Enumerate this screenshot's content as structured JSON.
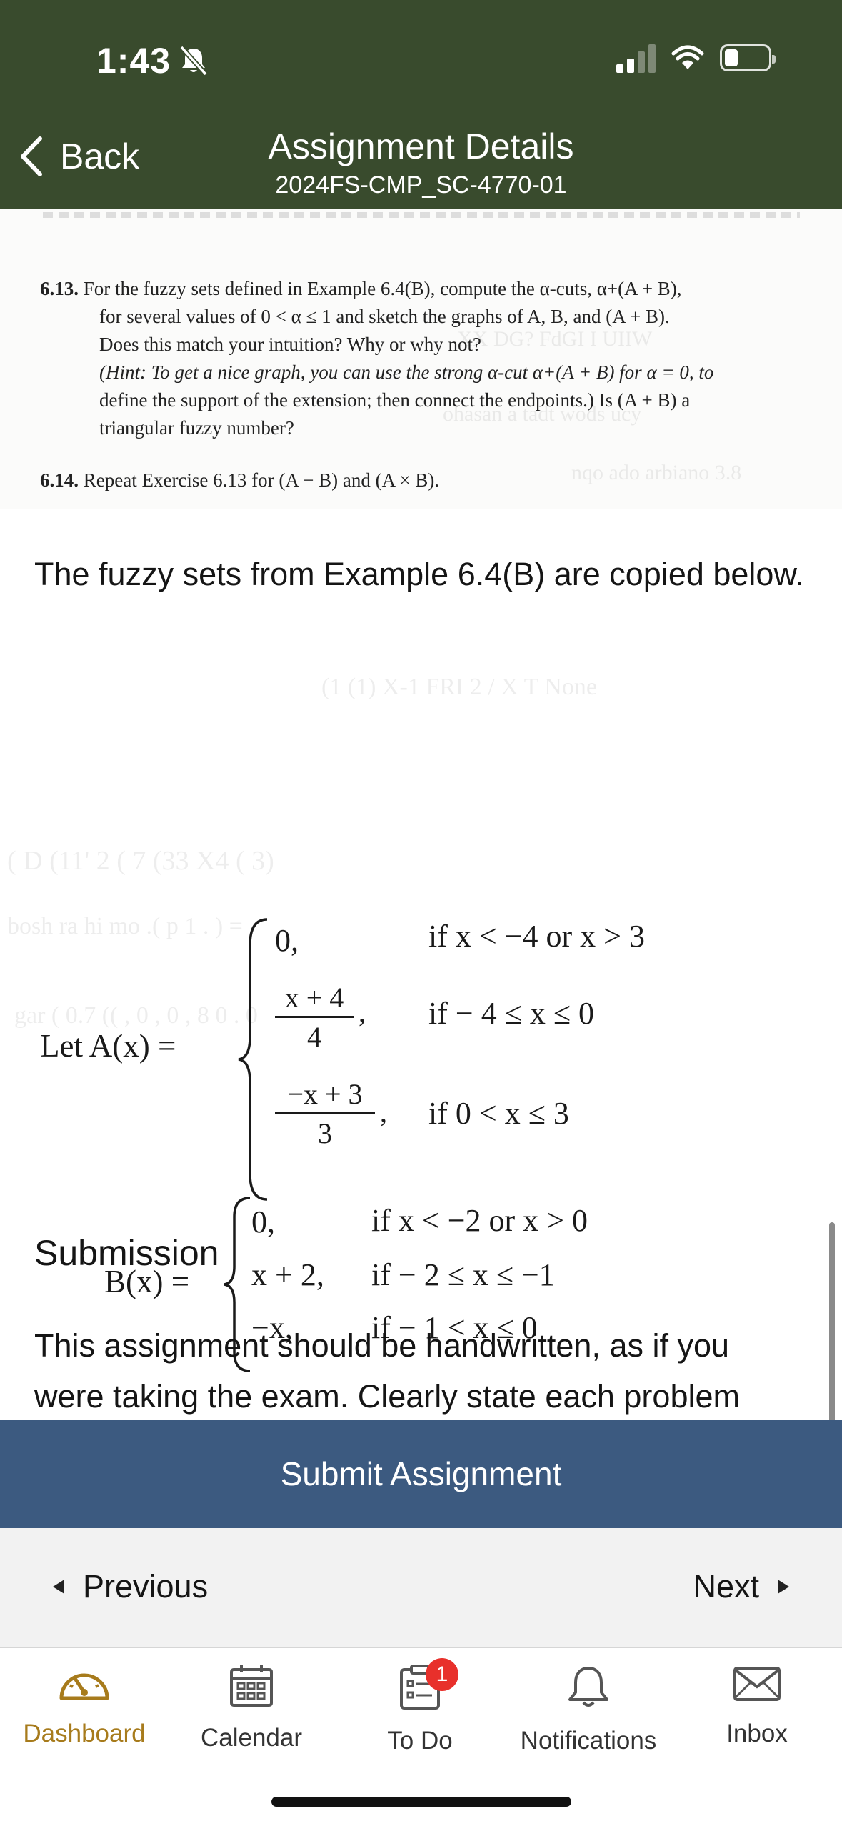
{
  "status_bar": {
    "time": "1:43"
  },
  "header": {
    "back_label": "Back",
    "title": "Assignment Details",
    "subtitle": "2024FS-CMP_SC-4770-01"
  },
  "exercises": [
    {
      "number": "6.13.",
      "lines": [
        "For the fuzzy sets defined in Example 6.4(B), compute the α-cuts, α+(A + B),",
        "for several values of 0 < α ≤ 1 and sketch the graphs of A, B, and (A + B).",
        "Does this match your intuition? Why or why not?",
        "(Hint: To get a nice graph, you can use the strong α-cut α+(A + B) for α = 0, to",
        "define the support of the extension; then connect the endpoints.) Is (A + B) a",
        "triangular fuzzy number?"
      ]
    },
    {
      "number": "6.14.",
      "lines": [
        "Repeat Exercise 6.13 for (A − B) and (A × B)."
      ]
    }
  ],
  "intro_text": "The fuzzy sets from Example 6.4(B) are copied below.",
  "math": {
    "a_lhs": "Let   A(x) =",
    "a_cases": [
      {
        "expr": "0,",
        "cond": "if x < −4 or x > 3"
      },
      {
        "num": "x + 4",
        "den": "4",
        "cond": "if  − 4 ≤ x ≤ 0"
      },
      {
        "num": "−x + 3",
        "den": "3",
        "cond": "if 0 < x ≤ 3"
      }
    ],
    "b_lhs": "B(x) =",
    "b_cases": [
      {
        "expr": "0,",
        "cond": "if x < −2 or x > 0"
      },
      {
        "expr": "x + 2,",
        "cond": "if  − 2 ≤ x ≤ −1"
      },
      {
        "expr": "−x,",
        "cond": "if  − 1 < x ≤ 0"
      }
    ]
  },
  "submission": {
    "heading": "Submission",
    "text": "This assignment should be handwritten, as if you were taking the exam. Clearly state each problem"
  },
  "submit_label": "Submit Assignment",
  "pager": {
    "previous": "Previous",
    "next": "Next"
  },
  "tabs": [
    {
      "label": "Dashboard",
      "icon": "dashboard-icon"
    },
    {
      "label": "Calendar",
      "icon": "calendar-icon"
    },
    {
      "label": "To Do",
      "icon": "todo-icon",
      "badge": "1"
    },
    {
      "label": "Notifications",
      "icon": "bell-icon"
    },
    {
      "label": "Inbox",
      "icon": "envelope-icon"
    }
  ],
  "colors": {
    "header_bg": "#394b2d",
    "submit_bg": "#3c5a80",
    "active_tab": "#a77b1c",
    "badge": "#e8302b"
  }
}
